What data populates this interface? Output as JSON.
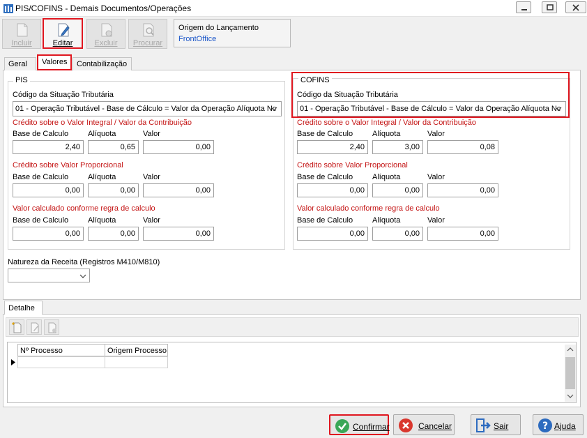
{
  "window": {
    "title": "PIS/COFINS - Demais Documentos/Operações"
  },
  "toolbar": {
    "incluir": "Incluir",
    "editar": "Editar",
    "excluir": "Excluir",
    "procurar": "Procurar"
  },
  "origem": {
    "label": "Origem do Lançamento",
    "value": "FrontOffice",
    "value_color": "#1a55c8"
  },
  "tabs": {
    "geral": "Geral",
    "valores": "Valores",
    "contabilizacao": "Contabilização"
  },
  "pis": {
    "title": "PIS",
    "cst_label": "Código da Situação Tributária",
    "cst_value": "01 - Operação Tributável - Base de Cálculo = Valor da Operação Alíquota Nc",
    "integral": {
      "title": "Crédito sobre o Valor Integral / Valor da Contribuição",
      "base": "2,40",
      "aliquota": "0,65",
      "valor": "0,00"
    },
    "proporcional": {
      "title": "Crédito sobre Valor Proporcional",
      "base": "0,00",
      "aliquota": "0,00",
      "valor": "0,00"
    },
    "calculado": {
      "title": "Valor calculado conforme regra de calculo",
      "base": "0,00",
      "aliquota": "0,00",
      "valor": "0,00"
    }
  },
  "cofins": {
    "title": "COFINS",
    "cst_label": "Código da Situação Tributária",
    "cst_value": "01 - Operação Tributável - Base de Cálculo = Valor da Operação Alíquota Nc",
    "integral": {
      "title": "Crédito sobre o Valor Integral / Valor da Contribuição",
      "base": "2,40",
      "aliquota": "3,00",
      "valor": "0,08"
    },
    "proporcional": {
      "title": "Crédito sobre Valor Proporcional",
      "base": "0,00",
      "aliquota": "0,00",
      "valor": "0,00"
    },
    "calculado": {
      "title": "Valor calculado conforme regra de calculo",
      "base": "0,00",
      "aliquota": "0,00",
      "valor": "0,00"
    }
  },
  "labels": {
    "base": "Base de Calculo",
    "aliquota": "Alíquota",
    "valor": "Valor"
  },
  "natureza": {
    "label": "Natureza da Receita (Registros M410/M810)",
    "value": ""
  },
  "detalhe": {
    "tab": "Detalhe",
    "columns": [
      "Nº Processo",
      "Origem Processo"
    ]
  },
  "buttons": {
    "confirmar": "Confirmar",
    "cancelar": "Cancelar",
    "sair": "Sair",
    "ajuda": "Ajuda"
  },
  "colors": {
    "highlight": "#e0161f",
    "section_red": "#c41414"
  }
}
